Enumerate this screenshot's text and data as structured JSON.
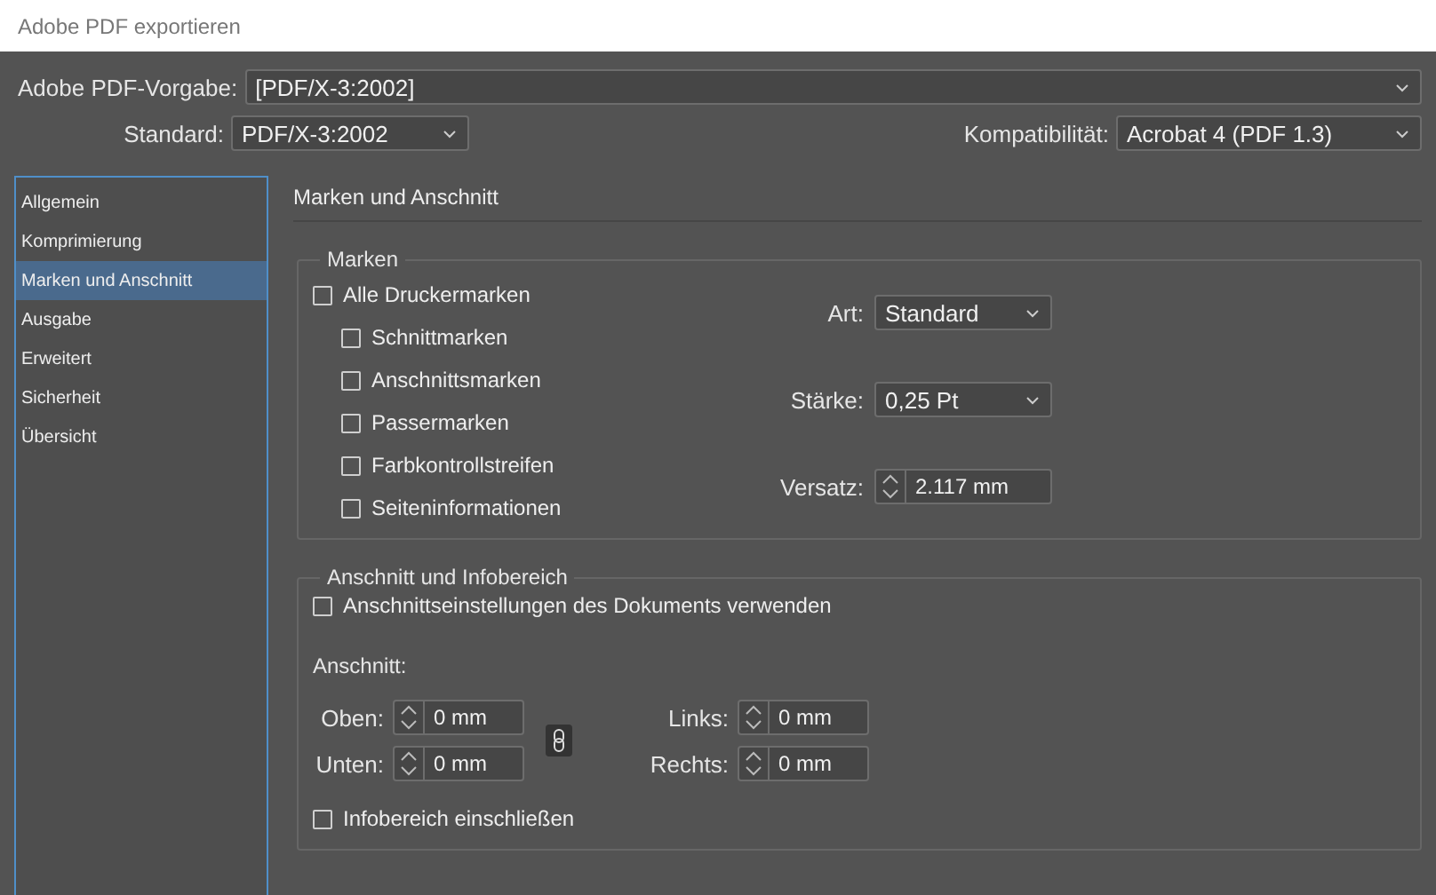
{
  "window": {
    "title": "Adobe PDF exportieren"
  },
  "preset": {
    "label": "Adobe PDF-Vorgabe:",
    "value": "[PDF/X-3:2002]"
  },
  "standard": {
    "label": "Standard:",
    "value": "PDF/X-3:2002"
  },
  "compatibility": {
    "label": "Kompatibilität:",
    "value": "Acrobat 4 (PDF 1.3)"
  },
  "sidebar": {
    "items": [
      {
        "label": "Allgemein",
        "selected": false
      },
      {
        "label": "Komprimierung",
        "selected": false
      },
      {
        "label": "Marken und Anschnitt",
        "selected": true
      },
      {
        "label": "Ausgabe",
        "selected": false
      },
      {
        "label": "Erweitert",
        "selected": false
      },
      {
        "label": "Sicherheit",
        "selected": false
      },
      {
        "label": "Übersicht",
        "selected": false
      }
    ]
  },
  "section_title": "Marken und Anschnitt",
  "marks": {
    "legend": "Marken",
    "all_marks": {
      "label": "Alle Druckermarken",
      "checked": false
    },
    "items": [
      {
        "label": "Schnittmarken",
        "checked": false
      },
      {
        "label": "Anschnittsmarken",
        "checked": false
      },
      {
        "label": "Passermarken",
        "checked": false
      },
      {
        "label": "Farbkontrollstreifen",
        "checked": false
      },
      {
        "label": "Seiteninformationen",
        "checked": false
      }
    ],
    "settings": [
      {
        "kind": "dropdown",
        "label": "Art:",
        "value": "Standard"
      },
      {
        "kind": "dropdown",
        "label": "Stärke:",
        "value": "0,25 Pt"
      },
      {
        "kind": "spinner",
        "label": "Versatz:",
        "value": "2.117 mm"
      }
    ]
  },
  "bleed": {
    "legend": "Anschnitt und Infobereich",
    "use_document": {
      "label": "Anschnittseinstellungen des Dokuments verwenden",
      "checked": false
    },
    "bleed_label": "Anschnitt:",
    "left_fields": [
      {
        "label": "Oben:",
        "value": "0 mm"
      },
      {
        "label": "Unten:",
        "value": "0 mm"
      }
    ],
    "right_fields": [
      {
        "label": "Links:",
        "value": "0 mm"
      },
      {
        "label": "Rechts:",
        "value": "0 mm"
      }
    ],
    "slug": {
      "label": "Infobereich einschließen",
      "checked": false
    }
  }
}
